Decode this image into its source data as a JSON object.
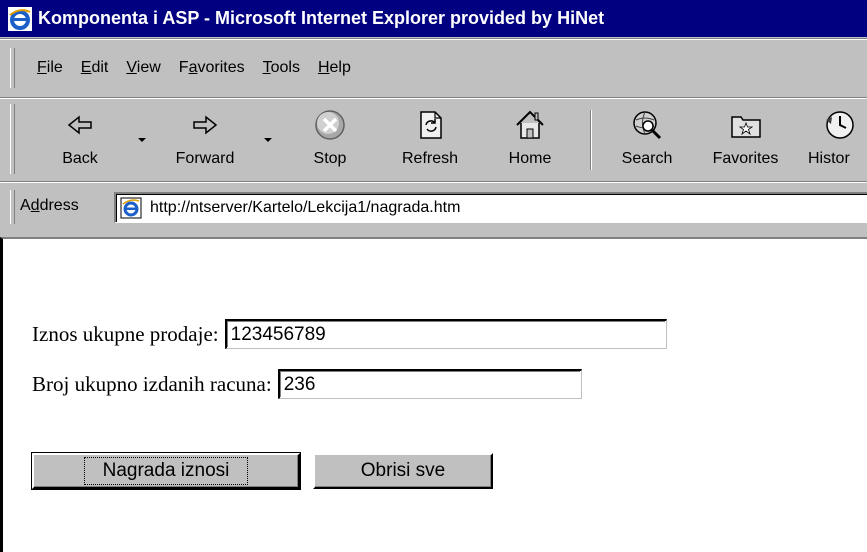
{
  "window": {
    "title": "Komponenta i ASP - Microsoft Internet Explorer provided by HiNet"
  },
  "menu": {
    "items": [
      {
        "pre": "",
        "accel": "F",
        "post": "ile"
      },
      {
        "pre": "",
        "accel": "E",
        "post": "dit"
      },
      {
        "pre": "",
        "accel": "V",
        "post": "iew"
      },
      {
        "pre": "F",
        "accel": "a",
        "post": "vorites"
      },
      {
        "pre": "",
        "accel": "T",
        "post": "ools"
      },
      {
        "pre": "",
        "accel": "H",
        "post": "elp"
      }
    ]
  },
  "toolbar": {
    "back": "Back",
    "forward": "Forward",
    "stop": "Stop",
    "refresh": "Refresh",
    "home": "Home",
    "search": "Search",
    "favorites": "Favorites",
    "history": "Histor"
  },
  "address": {
    "label_pre": "A",
    "label_accel": "d",
    "label_post": "dress",
    "url": "http://ntserver/Kartelo/Lekcija1/nagrada.htm"
  },
  "form": {
    "sales_label": "Iznos ukupne prodaje:",
    "sales_value": "123456789",
    "invoices_label": "Broj ukupno izdanih racuna:",
    "invoices_value": "236",
    "submit_label": "Nagrada iznosi",
    "reset_label": "Obrisi sve"
  },
  "colors": {
    "titlebar": "#000080",
    "chrome": "#c0c0c0",
    "content": "#ffffff"
  }
}
